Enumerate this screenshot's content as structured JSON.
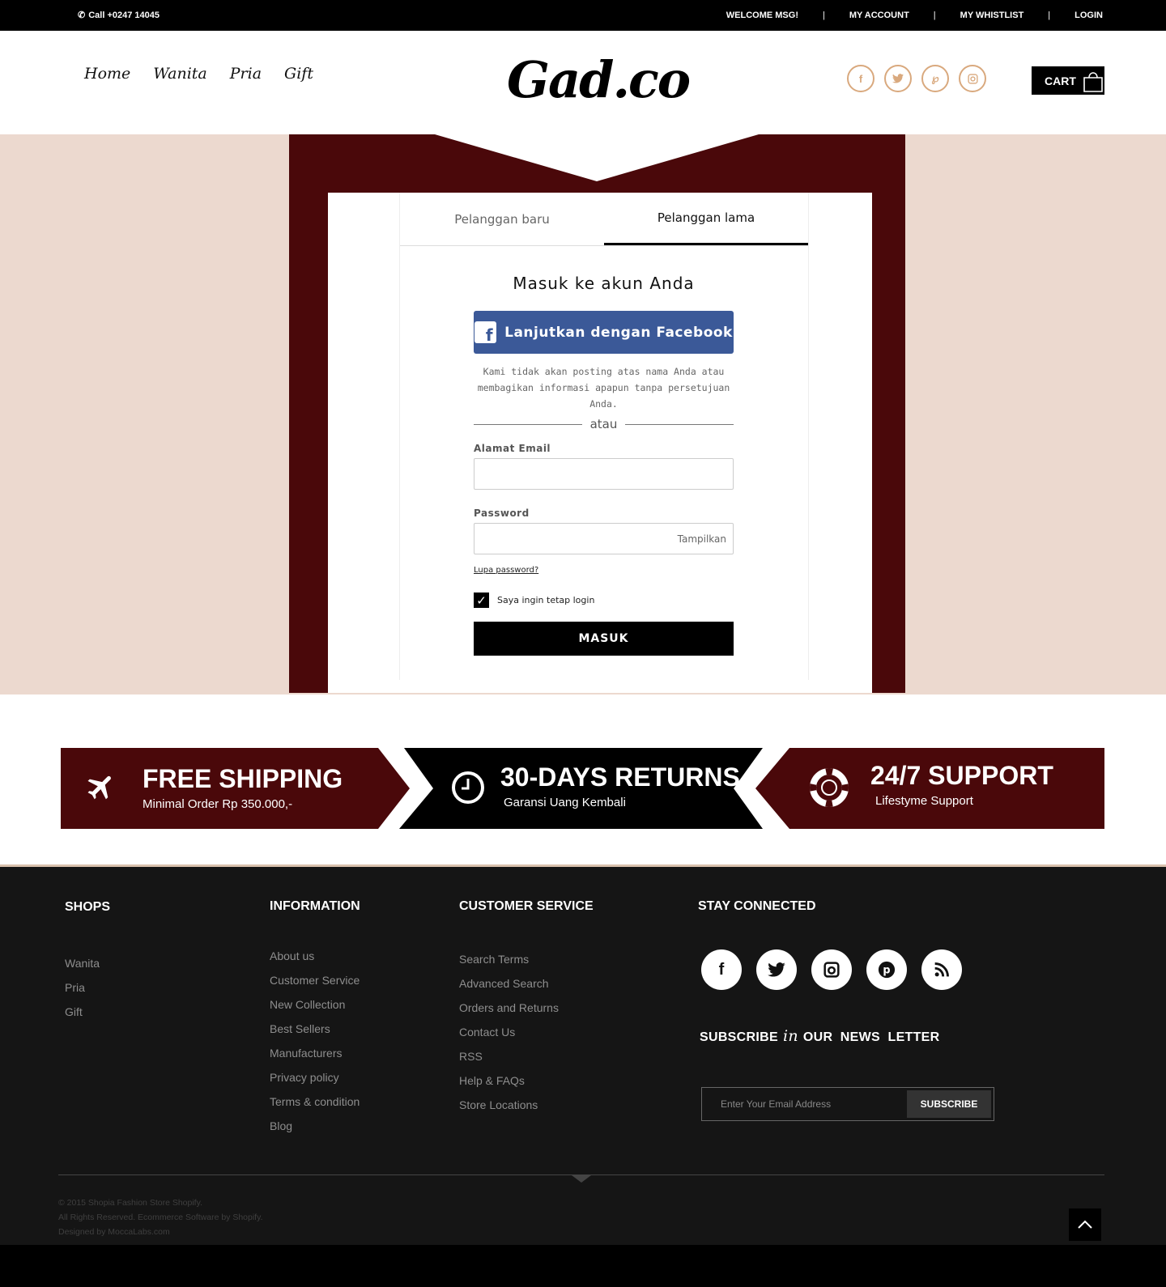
{
  "topbar": {
    "phone": "Call +0247 14045",
    "links": [
      "WELCOME MSG!",
      "MY ACCOUNT",
      "MY WHISTLIST",
      "LOGIN"
    ]
  },
  "header": {
    "nav": [
      "Home",
      "Wanita",
      "Pria",
      "Gift"
    ],
    "logo": "Gad.co",
    "social_icons": [
      "facebook-icon",
      "twitter-icon",
      "pinterest-icon",
      "instagram-icon"
    ],
    "cart_label": "CART"
  },
  "login": {
    "tabs": [
      {
        "label": "Pelanggan baru",
        "active": false
      },
      {
        "label": "Pelanggan lama",
        "active": true
      }
    ],
    "heading": "Masuk ke akun Anda",
    "facebook_button": "Lanjutkan dengan Facebook",
    "note": "Kami tidak akan posting atas nama Anda atau membagikan informasi apapun tanpa persetujuan Anda.",
    "divider": "atau",
    "email_label": "Alamat Email",
    "email_value": "",
    "password_label": "Password",
    "password_value": "",
    "show_password": "Tampilkan",
    "forgot": "Lupa password?",
    "remember": "Saya ingin tetap login",
    "remember_checked": true,
    "submit": "MASUK"
  },
  "features": [
    {
      "title": "FREE SHIPPING",
      "subtitle": "Minimal  Order Rp 350.000,-",
      "icon": "airplane-icon",
      "color": "#4a080a"
    },
    {
      "title": "30-DAYS RETURNS",
      "subtitle": "Garansi Uang Kembali",
      "icon": "clock-icon",
      "color": "#000000"
    },
    {
      "title": "24/7 SUPPORT",
      "subtitle": "Lifestyme Support",
      "icon": "lifebuoy-icon",
      "color": "#4a080a"
    }
  ],
  "footer": {
    "shops": {
      "title": "SHOPS",
      "items": [
        "Wanita",
        "Pria",
        "Gift"
      ]
    },
    "information": {
      "title": "INFORMATION",
      "items": [
        "About us",
        "Customer Service",
        "New Collection",
        "Best Sellers",
        "Manufacturers",
        "Privacy policy",
        "Terms & condition",
        "Blog"
      ]
    },
    "customer_service": {
      "title": "CUSTOMER SERVICE",
      "items": [
        "Search Terms",
        "Advanced Search",
        "Orders and Returns",
        "Contact Us",
        "RSS",
        "Help & FAQs",
        "Store Locations"
      ]
    },
    "stay_connected": {
      "title": "STAY CONNECTED",
      "social_icons": [
        "facebook-icon",
        "twitter-icon",
        "instagram-icon",
        "pinterest-icon",
        "rss-icon"
      ],
      "subscribe_pre": "SUBSCRIBE",
      "subscribe_in": "in",
      "subscribe_post": "OUR  NEWS  LETTER",
      "email_placeholder": "Enter Your Email Address",
      "subscribe_button": "SUBSCRIBE"
    },
    "copyright": [
      "© 2015  Shopia  Fashion Store Shopify.",
      "All Rights Reserved. Ecommerce Software by Shopify.",
      "Designed by  MoccaLabs.com"
    ]
  },
  "colors": {
    "maroon": "#4a080a",
    "beige": "#ecd9cf",
    "gold": "#d9a97e",
    "facebook": "#3b5998"
  }
}
